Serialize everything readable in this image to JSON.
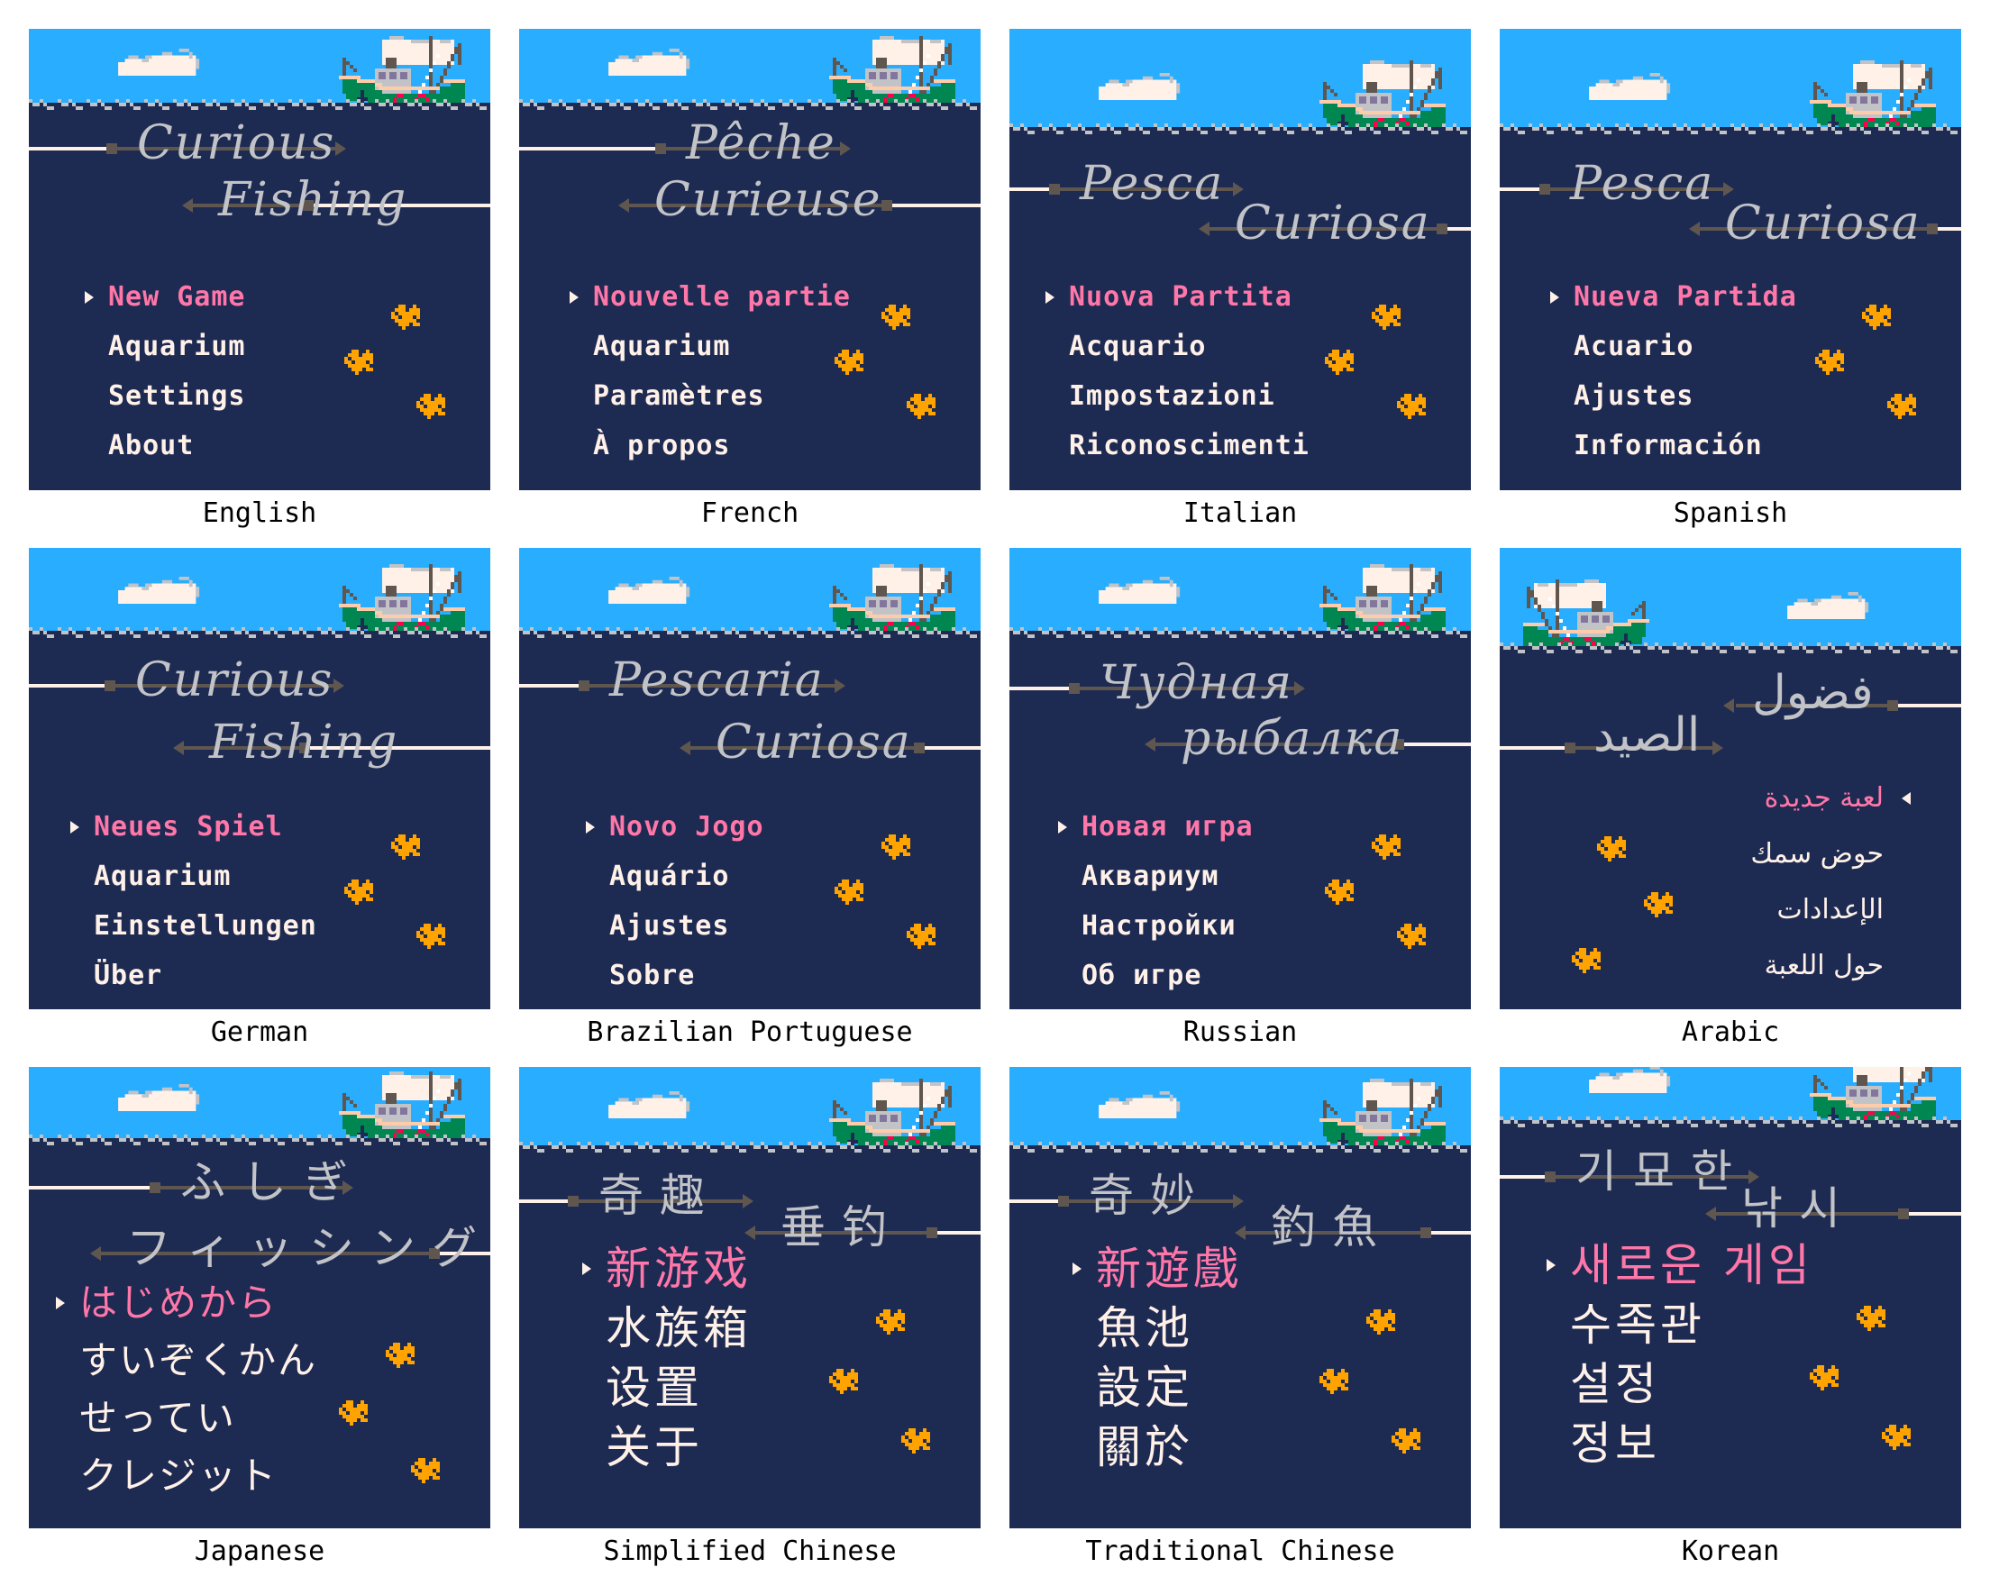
{
  "colors": {
    "sky": "#29adff",
    "water": "#1d2a52",
    "wave_crest": "#c2c3c7",
    "cloud": "#fff1e8",
    "cloud_shadow": "#c2c3c7",
    "title_text": "#c2c3c7",
    "fishing_line": "#fff1e8",
    "rod": "#5f574f",
    "menu_text": "#fff1e8",
    "menu_selected": "#ff77a8",
    "fish": "#ffa300",
    "boat_hull": "#008751",
    "boat_trim": "#ffccaa",
    "boat_cabin": "#c2c3c7",
    "boat_window": "#83769c",
    "boat_float": "#ff004d",
    "caption": "#000000"
  },
  "icons": {
    "cursor": "right-pointing-triangle",
    "cursor_rtl": "left-pointing-triangle",
    "fish": "orange-pixel-fish",
    "boat": "fishing-trawler",
    "cloud": "pixel-cloud"
  },
  "panels": [
    {
      "language": "English",
      "title": [
        "Curious",
        "Fishing"
      ],
      "menu": [
        "New Game",
        "Aquarium",
        "Settings",
        "About"
      ],
      "selected_index": 0,
      "direction": "ltr"
    },
    {
      "language": "French",
      "title": [
        "Pêche",
        "Curieuse"
      ],
      "menu": [
        "Nouvelle partie",
        "Aquarium",
        "Paramètres",
        "À propos"
      ],
      "selected_index": 0,
      "direction": "ltr"
    },
    {
      "language": "Italian",
      "title": [
        "Pesca",
        "Curiosa"
      ],
      "menu": [
        "Nuova Partita",
        "Acquario",
        "Impostazioni",
        "Riconoscimenti"
      ],
      "selected_index": 0,
      "direction": "ltr"
    },
    {
      "language": "Spanish",
      "title": [
        "Pesca",
        "Curiosa"
      ],
      "menu": [
        "Nueva Partida",
        "Acuario",
        "Ajustes",
        "Información"
      ],
      "selected_index": 0,
      "direction": "ltr"
    },
    {
      "language": "German",
      "title": [
        "Curious",
        "Fishing"
      ],
      "menu": [
        "Neues Spiel",
        "Aquarium",
        "Einstellungen",
        "Über"
      ],
      "selected_index": 0,
      "direction": "ltr"
    },
    {
      "language": "Brazilian Portuguese",
      "title": [
        "Pescaria",
        "Curiosa"
      ],
      "menu": [
        "Novo Jogo",
        "Aquário",
        "Ajustes",
        "Sobre"
      ],
      "selected_index": 0,
      "direction": "ltr"
    },
    {
      "language": "Russian",
      "title": [
        "Чудная",
        "рыбалка"
      ],
      "menu": [
        "Новая игра",
        "Аквариум",
        "Настройки",
        "Об игре"
      ],
      "selected_index": 0,
      "direction": "ltr"
    },
    {
      "language": "Arabic",
      "title": [
        "فضول",
        "الصيد"
      ],
      "menu": [
        "لعبة جديدة",
        "حوض سمك",
        "الإعدادات",
        "حول اللعبة"
      ],
      "selected_index": 0,
      "direction": "rtl"
    },
    {
      "language": "Japanese",
      "title": [
        "ふしぎ",
        "フィッシング"
      ],
      "menu": [
        "はじめから",
        "すいぞくかん",
        "せってい",
        "クレジット"
      ],
      "selected_index": 0,
      "direction": "ltr"
    },
    {
      "language": "Simplified Chinese",
      "title": [
        "奇趣",
        "垂钓"
      ],
      "menu": [
        "新游戏",
        "水族箱",
        "设置",
        "关于"
      ],
      "selected_index": 0,
      "direction": "ltr"
    },
    {
      "language": "Traditional Chinese",
      "title": [
        "奇妙",
        "釣魚"
      ],
      "menu": [
        "新遊戲",
        "魚池",
        "設定",
        "關於"
      ],
      "selected_index": 0,
      "direction": "ltr"
    },
    {
      "language": "Korean",
      "title": [
        "기묘한",
        "낚시"
      ],
      "menu": [
        "새로운 게임",
        "수족관",
        "설정",
        "정보"
      ],
      "selected_index": 0,
      "direction": "ltr"
    }
  ]
}
